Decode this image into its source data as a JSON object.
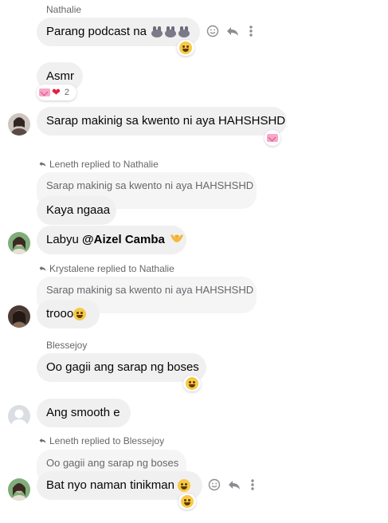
{
  "messages": [
    {
      "sender": "Nathalie",
      "text": "Parang podcast na",
      "reaction": "laughing-emoji"
    },
    {
      "text": "Asmr",
      "reaction_count": "2"
    },
    {
      "text": "Sarap makinig sa kwento ni aya HAHSHSHD"
    },
    {
      "reply_label": "Leneth replied to Nathalie",
      "quote": "Sarap makinig sa kwento ni aya HAHSHSHD",
      "text": "Kaya ngaaa"
    },
    {
      "text_prefix": "Labyu ",
      "mention": "@Aizel Camba"
    },
    {
      "reply_label": "Krystalene replied to Nathalie",
      "quote": "Sarap makinig sa kwento ni aya HAHSHSHD",
      "text": "trooo"
    },
    {
      "sender": "Blessejoy",
      "text": "Oo gagii ang sarap ng boses"
    },
    {
      "text": "Ang smooth e"
    },
    {
      "reply_label": "Leneth replied to Blessejoy",
      "quote": "Oo gagii ang sarap ng boses",
      "text": "Bat nyo naman tinikman"
    }
  ],
  "colors": {
    "bubble": "#f0f0f0",
    "quote_bubble": "#f5f5f5",
    "secondary_text": "#65676b",
    "heart": "#e41e3f"
  },
  "icons": {
    "react": "smiley-icon",
    "reply": "reply-arrow-icon",
    "more": "more-vertical-icon"
  }
}
